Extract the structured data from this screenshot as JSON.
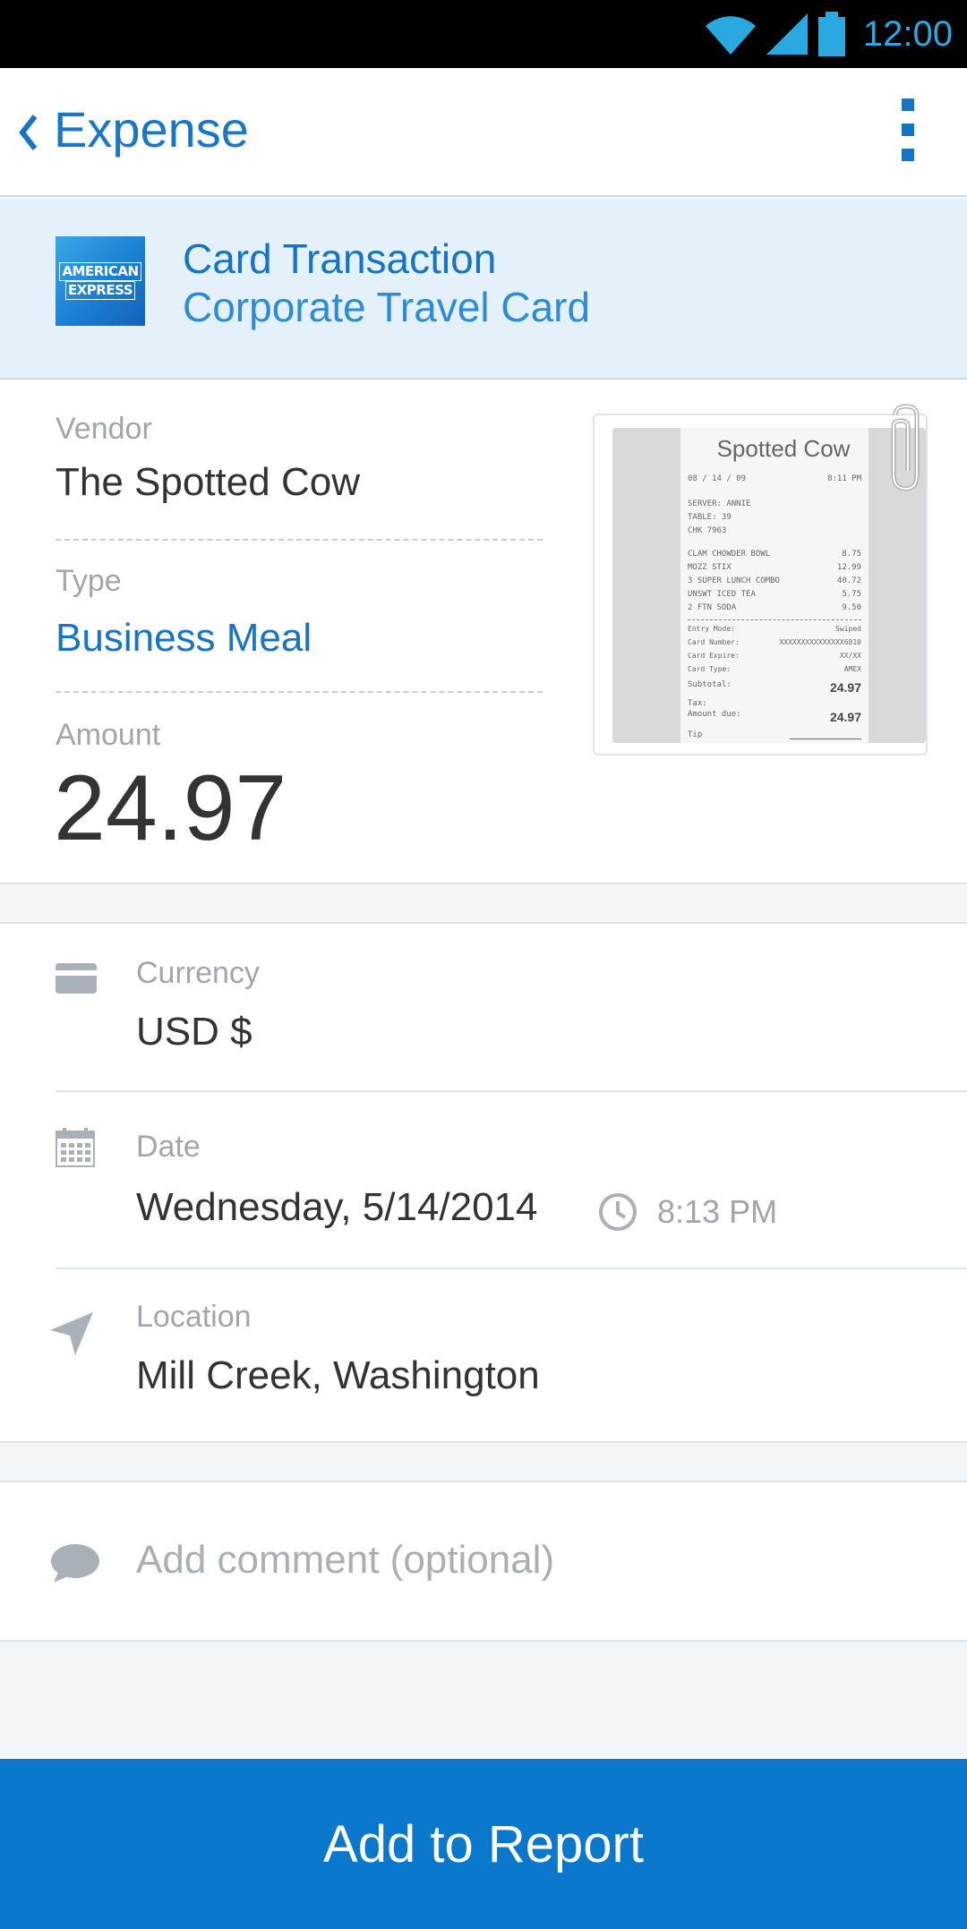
{
  "status_bar": {
    "time": "12:00"
  },
  "app_bar": {
    "title": "Expense"
  },
  "card": {
    "logo_line1": "AMERICAN",
    "logo_line2": "EXPRESS",
    "title": "Card Transaction",
    "subtitle": "Corporate Travel Card"
  },
  "details": {
    "vendor_label": "Vendor",
    "vendor_value": "The Spotted Cow",
    "type_label": "Type",
    "type_value": "Business Meal",
    "amount_label": "Amount",
    "amount_value": "24.97"
  },
  "receipt": {
    "header": "Spotted Cow",
    "date": "08 / 14 / 09",
    "time": "8:11 PM",
    "server": "SERVER: ANNIE",
    "table": "TABLE: 39",
    "check": "CHK 7963",
    "items": [
      {
        "name": "CLAM CHOWDER BOWL",
        "price": "8.75"
      },
      {
        "name": "MOZZ STIX",
        "price": "12.99"
      },
      {
        "name": "3 SUPER LUNCH COMBO",
        "price": "40.72"
      },
      {
        "name": "UNSWT ICED TEA",
        "price": "5.75"
      },
      {
        "name": "2 FTN SODA",
        "price": "9.50"
      }
    ],
    "entry_mode_label": "Entry Mode:",
    "entry_mode": "Swiped",
    "card_number_label": "Card Number:",
    "card_number": "XXXXXXXXXXXXXXX6810",
    "card_expire_label": "Card Expire:",
    "card_expire": "XX/XX",
    "card_type_label": "Card Type:",
    "card_type": "AMEX",
    "subtotal_label": "Subtotal:",
    "subtotal": "24.97",
    "tax_label": "Tax:",
    "amount_due_label": "Amount due:",
    "amount_due": "24.97",
    "tip_label": "Tip"
  },
  "info": {
    "currency_label": "Currency",
    "currency_value": "USD $",
    "date_label": "Date",
    "date_value": "Wednesday, 5/14/2014",
    "time_value": "8:13 PM",
    "location_label": "Location",
    "location_value": "Mill Creek, Washington"
  },
  "comment": {
    "placeholder": "Add comment (optional)"
  },
  "footer": {
    "button_label": "Add to Report"
  },
  "colors": {
    "accent": "#1674c8",
    "button": "#0a78cc",
    "band": "#e5f1fa"
  }
}
